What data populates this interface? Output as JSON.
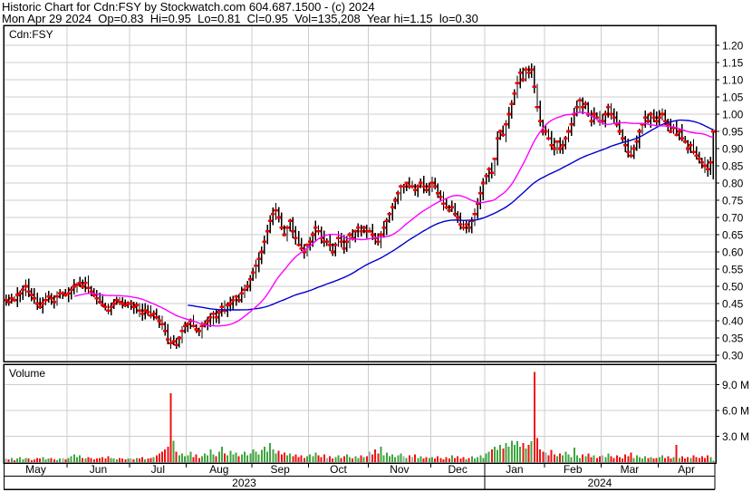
{
  "header": {
    "title_line": "Historic Chart for Cdn:FSY by Stockwatch.com 604.687.1500 - (c) 2024",
    "quote_line": "Mon Apr 29 2024  Op=0.83  Hi=0.95  Lo=0.81  Cl=0.95  Vol=135,208  Year hi=1.15  lo=0.30"
  },
  "panel": {
    "symbol_label": "Cdn:FSY",
    "volume_label": "Volume"
  },
  "axis": {
    "price_ticks": [
      "1.20",
      "1.15",
      "1.10",
      "1.05",
      "1.00",
      "0.95",
      "0.90",
      "0.85",
      "0.80",
      "0.75",
      "0.70",
      "0.65",
      "0.60",
      "0.55",
      "0.50",
      "0.45",
      "0.40",
      "0.35",
      "0.30"
    ],
    "volume_ticks": [
      {
        "value": 9.0,
        "label": "9.0 M"
      },
      {
        "value": 6.0,
        "label": "6.0 M"
      },
      {
        "value": 3.0,
        "label": "3.0 M"
      }
    ],
    "year_left": "2023",
    "year_right": "2024"
  },
  "colors": {
    "background": "#ffffff",
    "border": "#000000",
    "grid": "#cccccc",
    "bar": "#000000",
    "close_tick": "#ee0000",
    "ma_fast": "#ff00ff",
    "ma_slow": "#0000cd",
    "vol_up": "#3fa53f",
    "vol_down": "#ee1111",
    "vol_flat": "#a9a9a9"
  },
  "chart_data": {
    "type": "ohlc+volume",
    "symbol": "Cdn:FSY",
    "title": "Historic Chart for Cdn:FSY",
    "price_axis": {
      "min": 0.3,
      "max": 1.2,
      "step": 0.05
    },
    "volume_axis_millions": [
      3,
      6,
      9
    ],
    "ma_fast_period": 25,
    "ma_slow_period": 65,
    "year_high": 1.15,
    "year_low": 0.3,
    "last_bar_ohlc": {
      "open": 0.83,
      "high": 0.95,
      "low": 0.81,
      "close": 0.95,
      "volume": 135208
    },
    "months": [
      {
        "label": "May",
        "year": 2023,
        "days": 22,
        "closes": [
          0.46,
          0.455,
          0.465,
          0.46,
          0.475,
          0.48,
          0.49,
          0.5,
          0.485,
          0.475,
          0.465,
          0.45,
          0.44,
          0.45,
          0.46,
          0.47,
          0.465,
          0.455,
          0.47,
          0.48,
          0.48,
          0.475
        ],
        "volumes_m": [
          0.4,
          0.3,
          0.5,
          0.2,
          0.4,
          0.6,
          0.3,
          0.5,
          0.4,
          0.2,
          0.3,
          0.5,
          0.4,
          0.6,
          0.3,
          0.4,
          0.5,
          0.3,
          0.2,
          0.4,
          0.5,
          0.3
        ]
      },
      {
        "label": "Jun",
        "year": 2023,
        "days": 22,
        "closes": [
          0.48,
          0.49,
          0.5,
          0.505,
          0.51,
          0.5,
          0.51,
          0.495,
          0.485,
          0.475,
          0.465,
          0.455,
          0.445,
          0.44,
          0.43,
          0.44,
          0.45,
          0.46,
          0.455,
          0.45,
          0.445,
          0.45
        ],
        "volumes_m": [
          0.5,
          0.7,
          0.9,
          0.6,
          0.8,
          0.5,
          0.4,
          0.6,
          0.5,
          0.3,
          0.4,
          0.5,
          0.6,
          0.4,
          0.7,
          0.5,
          0.4,
          0.3,
          0.5,
          0.4,
          0.3,
          0.4
        ]
      },
      {
        "label": "Jul",
        "year": 2023,
        "days": 20,
        "closes": [
          0.45,
          0.44,
          0.445,
          0.43,
          0.42,
          0.43,
          0.425,
          0.415,
          0.42,
          0.41,
          0.4,
          0.39,
          0.37,
          0.345,
          0.335,
          0.34,
          0.33,
          0.35,
          0.37,
          0.385
        ],
        "volumes_m": [
          0.4,
          0.3,
          0.5,
          0.4,
          0.6,
          0.3,
          0.4,
          0.5,
          0.6,
          0.8,
          1.0,
          1.2,
          1.5,
          1.8,
          8.0,
          2.5,
          1.2,
          0.8,
          1.0,
          0.7
        ]
      },
      {
        "label": "Aug",
        "year": 2023,
        "days": 23,
        "closes": [
          0.39,
          0.4,
          0.385,
          0.375,
          0.37,
          0.385,
          0.39,
          0.4,
          0.41,
          0.42,
          0.41,
          0.425,
          0.44,
          0.43,
          0.445,
          0.45,
          0.46,
          0.47,
          0.46,
          0.48,
          0.49,
          0.5,
          0.52
        ],
        "volumes_m": [
          0.8,
          1.2,
          0.6,
          0.9,
          0.5,
          0.7,
          1.0,
          0.8,
          1.5,
          0.9,
          0.7,
          1.2,
          1.8,
          1.0,
          0.8,
          1.3,
          0.9,
          1.1,
          0.7,
          0.9,
          1.2,
          0.8,
          1.0
        ]
      },
      {
        "label": "Sep",
        "year": 2023,
        "days": 20,
        "closes": [
          0.54,
          0.56,
          0.58,
          0.6,
          0.63,
          0.66,
          0.69,
          0.71,
          0.72,
          0.7,
          0.67,
          0.65,
          0.67,
          0.69,
          0.66,
          0.64,
          0.62,
          0.61,
          0.6,
          0.62
        ],
        "volumes_m": [
          1.5,
          1.2,
          0.9,
          1.4,
          1.8,
          1.2,
          2.2,
          1.5,
          1.0,
          1.3,
          0.9,
          1.1,
          0.8,
          1.0,
          0.7,
          0.9,
          0.6,
          0.8,
          0.5,
          0.7
        ]
      },
      {
        "label": "Oct",
        "year": 2023,
        "days": 21,
        "closes": [
          0.63,
          0.65,
          0.67,
          0.66,
          0.64,
          0.63,
          0.63,
          0.62,
          0.6,
          0.62,
          0.64,
          0.63,
          0.61,
          0.63,
          0.65,
          0.64,
          0.66,
          0.67,
          0.66,
          0.67,
          0.66
        ],
        "volumes_m": [
          0.9,
          0.7,
          1.1,
          0.8,
          0.6,
          0.9,
          0.5,
          0.7,
          0.4,
          0.6,
          0.8,
          0.5,
          0.7,
          0.9,
          0.6,
          0.4,
          0.7,
          0.5,
          0.8,
          0.6,
          0.7
        ]
      },
      {
        "label": "Nov",
        "year": 2023,
        "days": 22,
        "closes": [
          0.66,
          0.65,
          0.64,
          0.63,
          0.65,
          0.67,
          0.69,
          0.71,
          0.73,
          0.75,
          0.77,
          0.79,
          0.79,
          0.8,
          0.79,
          0.79,
          0.78,
          0.79,
          0.8,
          0.79,
          0.78,
          0.79
        ],
        "volumes_m": [
          1.2,
          0.9,
          1.5,
          1.0,
          1.8,
          0.8,
          1.1,
          0.7,
          0.9,
          0.6,
          0.8,
          1.0,
          0.7,
          0.5,
          0.8,
          0.6,
          0.9,
          0.5,
          0.7,
          0.4,
          0.6,
          0.5
        ]
      },
      {
        "label": "Dec",
        "year": 2023,
        "days": 19,
        "closes": [
          0.8,
          0.79,
          0.77,
          0.76,
          0.74,
          0.73,
          0.72,
          0.73,
          0.71,
          0.7,
          0.68,
          0.67,
          0.68,
          0.67,
          0.69,
          0.71,
          0.74,
          0.77,
          0.8
        ],
        "volumes_m": [
          0.6,
          0.4,
          0.7,
          0.5,
          0.3,
          0.6,
          0.4,
          0.8,
          0.5,
          0.7,
          0.4,
          0.6,
          0.3,
          0.5,
          0.7,
          0.4,
          0.6,
          0.8,
          0.5
        ]
      },
      {
        "label": "Jan",
        "year": 2024,
        "days": 21,
        "closes": [
          0.82,
          0.84,
          0.83,
          0.87,
          0.93,
          0.95,
          0.94,
          0.97,
          1.0,
          1.03,
          1.06,
          1.09,
          1.12,
          1.1,
          1.13,
          1.12,
          1.13,
          1.08,
          1.02,
          0.98,
          0.95
        ],
        "volumes_m": [
          1.0,
          1.2,
          1.5,
          1.8,
          1.4,
          2.0,
          1.6,
          2.2,
          1.8,
          2.5,
          2.0,
          2.4,
          1.8,
          2.2,
          1.6,
          2.0,
          2.4,
          10.5,
          2.8,
          1.5,
          1.2
        ]
      },
      {
        "label": "Feb",
        "year": 2024,
        "days": 20,
        "closes": [
          0.95,
          0.93,
          0.91,
          0.9,
          0.92,
          0.9,
          0.91,
          0.93,
          0.95,
          0.97,
          1.0,
          1.02,
          1.04,
          1.02,
          1.03,
          1.0,
          0.98,
          1.0,
          0.99,
          0.98
        ],
        "volumes_m": [
          1.1,
          0.8,
          1.4,
          0.9,
          0.7,
          1.0,
          0.8,
          1.2,
          0.9,
          0.6,
          1.7,
          0.8,
          0.5,
          0.9,
          0.7,
          1.0,
          0.6,
          0.8,
          0.5,
          0.7
        ]
      },
      {
        "label": "Mar",
        "year": 2024,
        "days": 20,
        "closes": [
          0.98,
          1.0,
          1.02,
          1.0,
          0.99,
          0.97,
          0.95,
          0.93,
          0.91,
          0.89,
          0.88,
          0.9,
          0.92,
          0.95,
          0.97,
          0.99,
          0.98,
          1.0,
          0.99,
          0.98
        ],
        "volumes_m": [
          0.8,
          0.6,
          1.0,
          0.7,
          0.5,
          0.8,
          0.6,
          0.4,
          0.9,
          0.7,
          1.1,
          0.5,
          0.8,
          0.6,
          0.4,
          0.7,
          0.5,
          0.6,
          0.4,
          0.5
        ]
      },
      {
        "label": "Apr",
        "year": 2024,
        "days": 20,
        "closes": [
          0.99,
          1.0,
          0.98,
          0.97,
          0.95,
          0.96,
          0.94,
          0.95,
          0.93,
          0.92,
          0.9,
          0.91,
          0.89,
          0.88,
          0.87,
          0.86,
          0.85,
          0.84,
          0.86,
          0.95
        ],
        "volumes_m": [
          0.6,
          0.8,
          0.5,
          0.7,
          0.4,
          0.6,
          2.0,
          0.5,
          0.7,
          0.4,
          0.6,
          0.5,
          0.8,
          0.6,
          0.5,
          0.7,
          0.5,
          0.8,
          0.6,
          0.14
        ]
      }
    ]
  }
}
